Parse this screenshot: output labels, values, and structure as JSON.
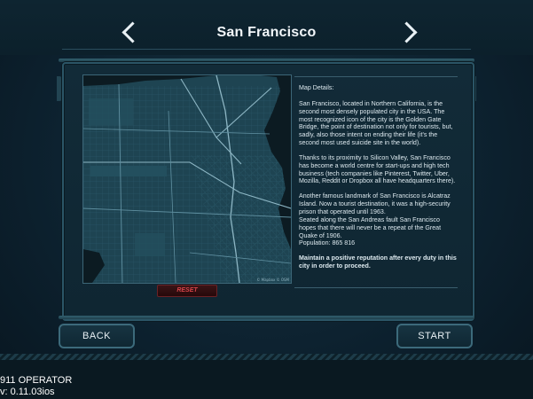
{
  "header": {
    "title": "San Francisco"
  },
  "map": {
    "attribution": "© Mapbox © OSM"
  },
  "details": {
    "label": "Map Details:",
    "paragraphs": [
      "San Francisco, located in Northern California, is the second most densely populated city in the USA. The most recognized icon of the city is the Golden Gate Bridge, the point of destination not only for tourists, but, sadly, also those intent on ending their life (it's the second most used suicide site in the world).",
      "Thanks to its proximity to Silicon Valley, San Francisco has become a world centre for start-ups and high tech business (tech companies like Pinterest, Twitter, Uber, Mozilla, Reddit or Dropbox all have headquarters there).",
      "Another famous landmark of San Francisco is Alcatraz Island. Now a tourist destination, it was a high-security prison that operated until 1963.",
      "Seated along the San Andreas fault San Francisco hopes that there will never be a repeat of the Great Quake of 1906.",
      "Population: 865 816"
    ],
    "requirement": "Maintain a positive reputation after every duty in this city in order to proceed."
  },
  "buttons": {
    "reset": "RESET",
    "back": "BACK",
    "start": "START"
  },
  "footer": {
    "app_name": "911 OPERATOR",
    "version": "v: 0.11.03ios"
  },
  "colors": {
    "background": "#0b1a24",
    "panel_border": "#2b5566",
    "reset_text": "#d8444a",
    "map_land": "#1e4452",
    "map_water": "#0c1b22"
  }
}
